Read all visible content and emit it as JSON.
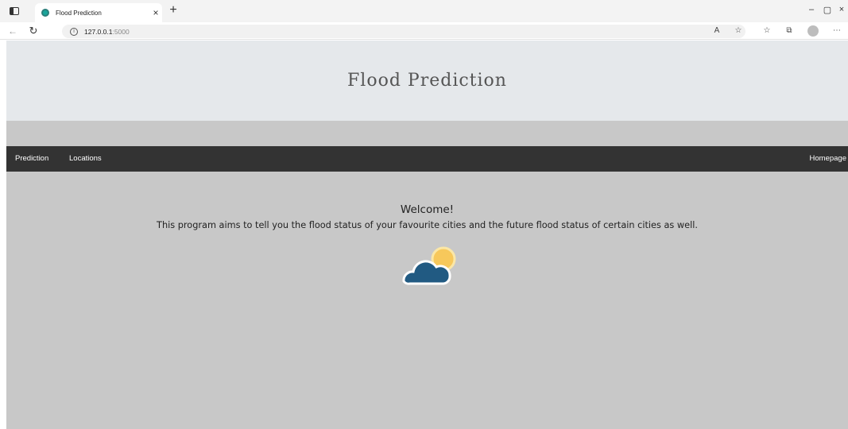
{
  "browser": {
    "tab_title": "Flood Prediction",
    "tab_close": "×",
    "new_tab": "+",
    "url_host": "127.0.0.1",
    "url_port": ":5000",
    "window_controls": {
      "minimize": "–",
      "restore": "▢",
      "close": "×"
    }
  },
  "page": {
    "header_title": "Flood Prediction",
    "nav": {
      "left": [
        "Prediction",
        "Locations"
      ],
      "right": "Homepage"
    },
    "welcome": "Welcome!",
    "description": "This program aims to tell you the flood status of your favourite cities and the future flood status of certain cities as well.",
    "icon": "cloud-sun-icon",
    "colors": {
      "header_bg": "#e5e8eb",
      "body_bg": "#c8c8c8",
      "navbar_bg": "#333333",
      "cloud": "#215a82",
      "sun": "#f7c85b"
    }
  }
}
